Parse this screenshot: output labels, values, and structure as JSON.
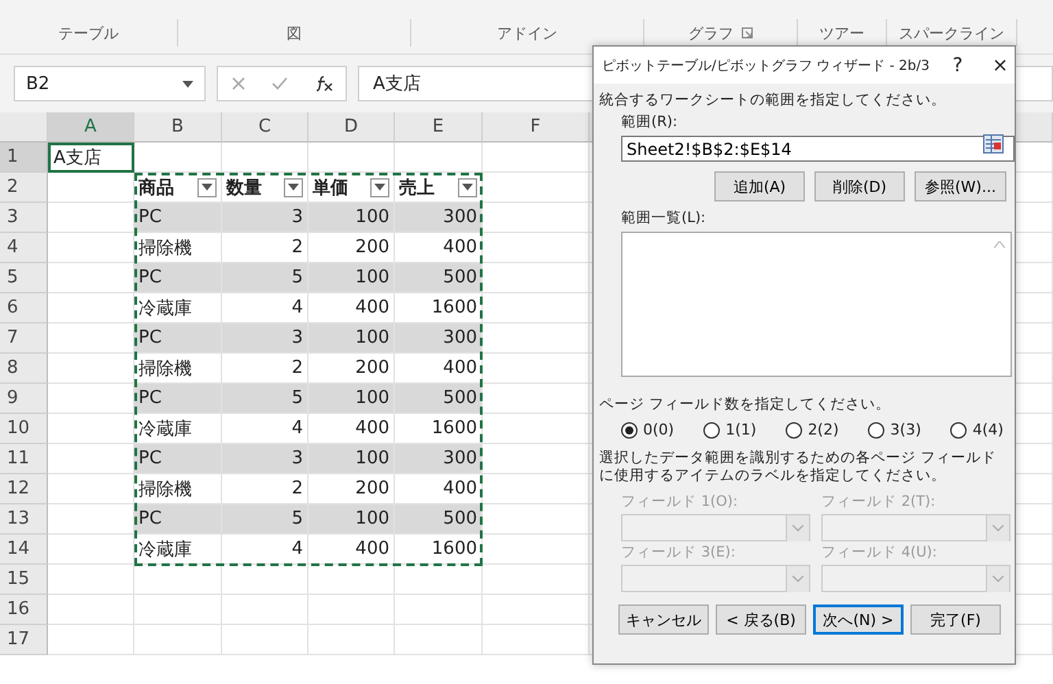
{
  "ribbon_groups": [
    {
      "label": "テーブル",
      "launcher": false
    },
    {
      "label": "図",
      "launcher": false
    },
    {
      "label": "アドイン",
      "launcher": false
    },
    {
      "label": "グラフ",
      "launcher": true
    },
    {
      "label": "ツアー",
      "launcher": false
    },
    {
      "label": "スパークライン",
      "launcher": false
    }
  ],
  "name_box": "B2",
  "formula": "A支店",
  "columns": [
    "A",
    "B",
    "C",
    "D",
    "E",
    "F"
  ],
  "row_numbers": [
    "1",
    "2",
    "3",
    "4",
    "5",
    "6",
    "7",
    "8",
    "9",
    "10",
    "11",
    "12",
    "13",
    "14",
    "15",
    "16",
    "17"
  ],
  "active_cell": {
    "text": "A支店"
  },
  "table": {
    "headers": [
      "商品",
      "数量",
      "単価",
      "売上"
    ],
    "rows": [
      [
        "PC",
        "3",
        "100",
        "300"
      ],
      [
        "掃除機",
        "2",
        "200",
        "400"
      ],
      [
        "PC",
        "5",
        "100",
        "500"
      ],
      [
        "冷蔵庫",
        "4",
        "400",
        "1600"
      ],
      [
        "PC",
        "3",
        "100",
        "300"
      ],
      [
        "掃除機",
        "2",
        "200",
        "400"
      ],
      [
        "PC",
        "5",
        "100",
        "500"
      ],
      [
        "冷蔵庫",
        "4",
        "400",
        "1600"
      ],
      [
        "PC",
        "3",
        "100",
        "300"
      ],
      [
        "掃除機",
        "2",
        "200",
        "400"
      ],
      [
        "PC",
        "5",
        "100",
        "500"
      ],
      [
        "冷蔵庫",
        "4",
        "400",
        "1600"
      ]
    ]
  },
  "dialog": {
    "title": "ピボットテーブル/ピボットグラフ ウィザード - 2b/3",
    "help": "?",
    "close": "×",
    "prompt": "統合するワークシートの範囲を指定してください。",
    "range_label": "範囲(R):",
    "range_value": "Sheet2!$B$2:$E$14",
    "range_buttons": [
      "追加(A)",
      "削除(D)",
      "参照(W)..."
    ],
    "list_label": "範囲一覧(L):",
    "page_field_prompt": "ページ フィールド数を指定してください。",
    "radios": [
      {
        "label": "0(0)",
        "selected": true
      },
      {
        "label": "1(1)",
        "selected": false
      },
      {
        "label": "2(2)",
        "selected": false
      },
      {
        "label": "3(3)",
        "selected": false
      },
      {
        "label": "4(4)",
        "selected": false
      }
    ],
    "instruction": "選択したデータ範囲を識別するための各ページ フィールドに使用するアイテムのラベルを指定してください。",
    "fields": [
      {
        "label": "フィールド 1(O):",
        "disabled": true
      },
      {
        "label": "フィールド 2(T):",
        "disabled": true
      },
      {
        "label": "フィールド 3(E):",
        "disabled": true
      },
      {
        "label": "フィールド 4(U):",
        "disabled": true
      }
    ],
    "buttons": [
      {
        "label": "キャンセル",
        "default": false
      },
      {
        "label": "< 戻る(B)",
        "default": false
      },
      {
        "label": "次へ(N) >",
        "default": true
      },
      {
        "label": "完了(F)",
        "default": false
      }
    ]
  }
}
